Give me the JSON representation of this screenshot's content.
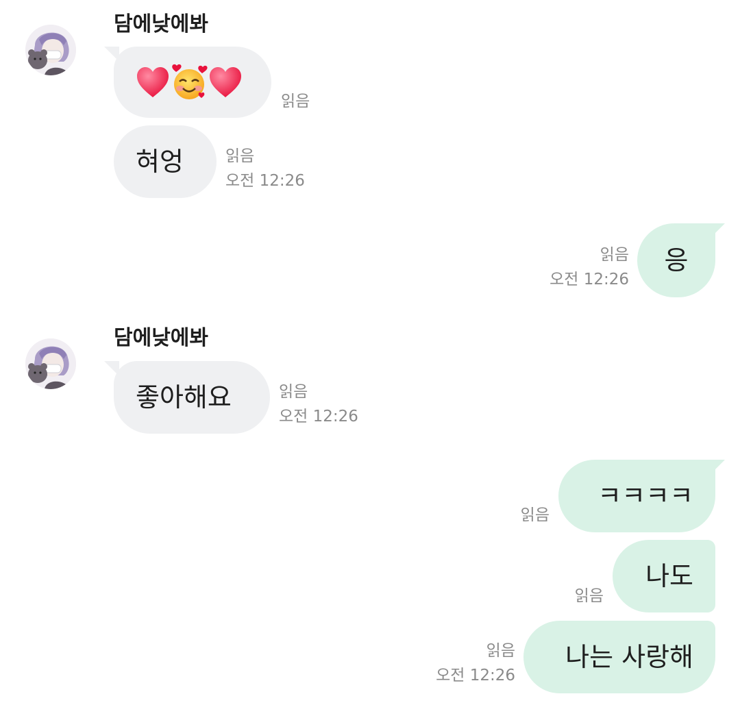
{
  "contact": {
    "name": "담에낮에봐"
  },
  "read_label": "읽음",
  "messages": [
    {
      "text": "",
      "emoji": [
        "heart-icon",
        "smiling-face-with-hearts-icon",
        "heart-icon"
      ],
      "read": "읽음"
    },
    {
      "text": "혀엉",
      "read": "읽음",
      "time": "오전 12:26"
    },
    {
      "text": "응",
      "read": "읽음",
      "time": "오전 12:26"
    },
    {
      "text": "좋아해요",
      "read": "읽음",
      "time": "오전 12:26"
    },
    {
      "text": "ㅋㅋㅋㅋ",
      "read": "읽음"
    },
    {
      "text": "나도",
      "read": "읽음"
    },
    {
      "text": "나는 사랑해",
      "read": "읽음",
      "time": "오전 12:26"
    }
  ],
  "colors": {
    "incoming_bubble": "#eff0f2",
    "outgoing_bubble": "#d9f2e6",
    "meta_text": "#8a8a8a"
  }
}
